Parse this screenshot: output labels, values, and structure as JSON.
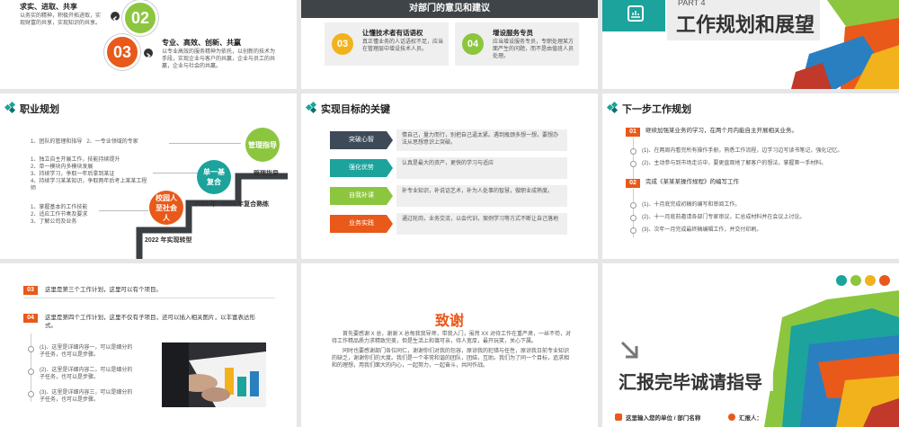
{
  "slide1": {
    "item_top_title": "求实、进取、共享",
    "item_top_desc": "以务实的精神，积极开拓进取，实现财富的共享，实现知识的共享。",
    "num_02": "02",
    "num_03": "03",
    "item3_title": "专业、高效、创新、共赢",
    "item3_desc": "以专业高效的服务精神为依托，以创新的技术为手段，实现企业与客户的共赢，企业与员工的共赢，企业与社会的共赢。"
  },
  "slide2": {
    "title": "对部门的意见和建议",
    "num1": "03",
    "card1_title": "让懂技术者有话语权",
    "card1_desc": "真正懂业务的人话语权不足，应当在管理层中增设技术人员。",
    "num2": "04",
    "card2_title": "增设服务专员",
    "card2_desc": "应当增设服务专员，专职处理某方面严生的问题，而不是由值班人员处理。"
  },
  "slide3": {
    "part_label": "PART 4",
    "title": "工作规划和展望"
  },
  "slide4": {
    "title": "职业规划",
    "list1": [
      "1、团队的管理和指导",
      "2、一专业领域的专家"
    ],
    "list2": [
      "1、独立自主开展工作，技能持续提升",
      "2、单一模块内多模块发展",
      "3、持续学习，争取一年后拿到某证",
      "4、持续学习某某知识，争取两年后考上某某工程师"
    ],
    "list3": [
      "1、掌握基本的工作技能",
      "2、适应工作节奏及要求",
      "3、了解公司及业务"
    ],
    "stage_top": "管理指导",
    "stage_top_label": "管理指导",
    "stage_mid": "单一基复合",
    "stage_mid_label": "2023 年 ~2024 年复合熟练",
    "stage_low": "校园人至社会人",
    "stage_low_label": "2022 年实现转型"
  },
  "slide5": {
    "title": "实现目标的关键",
    "rows": [
      {
        "label": "突破心智",
        "color": "#3e4a58",
        "text": "情自己，量力而行，别把自己逼太紧。遇到瓶颈多想一想，要想办法从思想意识上突破。"
      },
      {
        "label": "强化优势",
        "color": "#1ba39c",
        "text": "认真是最大的资产，更快的学习与适应"
      },
      {
        "label": "自我补课",
        "color": "#8cc63f",
        "text": "补专业知识，补说话艺术，补为人处事的智慧，做职业成熟度。"
      },
      {
        "label": "业务实践",
        "color": "#e8591a",
        "text": "通过轮岗，业务交流，以会代训，案例学习等方式不断让自己落地"
      }
    ]
  },
  "slide6": {
    "title": "下一步工作规划",
    "num1": "01",
    "item1_title": "继续加强某业务的学习，在两个月内能自主开展相关业务。",
    "item1_subs": [
      "(1)、在两周内看完所有操作手册，熟悉工作流程，边学习边写读书笔记，强化记忆。",
      "(2)、主动参与到市场走访中，要更直观地了解客户的想法，掌握第一手材料。"
    ],
    "num2": "02",
    "item2_title": "完成《某某某操作规程》的编写工作",
    "item2_subs": [
      "(1)、十月底完成初稿的编写和审阅工作。",
      "(2)、十一月底前邀请各部门专家审议，汇总成材料并在会议上讨论。",
      "(3)、次年一月完成最终稿编辑工作，并交付印刷。"
    ]
  },
  "slide7": {
    "num3": "03",
    "item3": "这里是第三个工作计划，这里可以有个项目。",
    "num4": "04",
    "item4": "这里是第四个工作计划，这里不仅有子项目，还可以插入相关图片，以丰富表达形式。",
    "subs": [
      "(1)、这里是详细内容一，可以是细分的子任务，也可以是步骤。",
      "(2)、这里是详细内容二，可以是细分的子任务，也可以是步骤。",
      "(3)、这里是详细内容三，可以是细分的子任务，也可以是步骤。"
    ]
  },
  "slide8": {
    "title": "致谢",
    "para1": "首先要感谢 X 总，谢谢 X 总每我我导师，带我入门，虽然 XX 对待工作在重严肃，一丝不苟，对待工作精品质力求精致完美，但是生活上和蔼可亲，待人宽厚，最开玩笑，关心下属。",
    "para2": "同时也要感谢部门各位同仁，谢谢你们对我的包容，原谅我的犯错与任性，原谅我日前专业知识的缺乏，谢谢你们的大度。我们是一个非常和谐的团队，团结，互助。我们为了同一个目标，追求相和的理想，用我们面大的内心，一起努力，一起奋斗，共同作战。"
  },
  "slide9": {
    "title": "汇报完毕诚请指导",
    "unit_label": "这里输入您的单位 / 部门名称",
    "reporter_label": "汇报人："
  },
  "colors": {
    "teal": "#1ba39c",
    "orange": "#e8591a",
    "green": "#8cc63f",
    "yellow": "#f2b21c",
    "dark": "#3e4a58"
  }
}
